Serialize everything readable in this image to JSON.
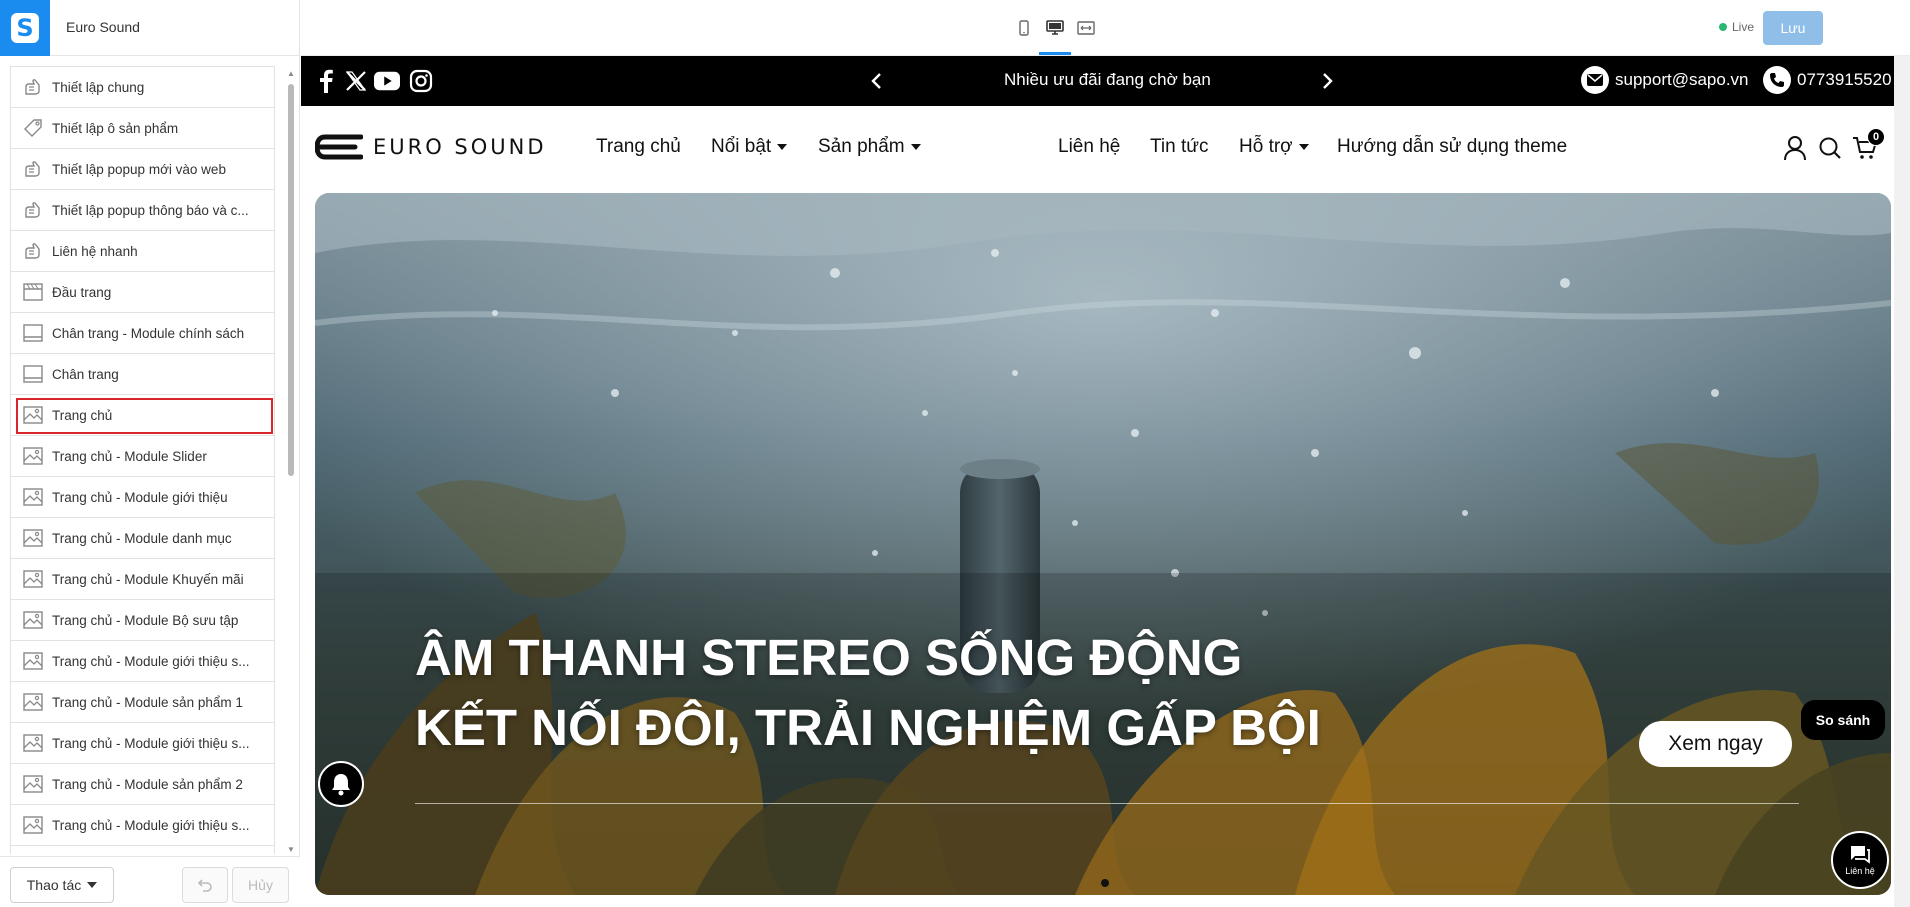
{
  "app": {
    "store_name": "Euro Sound",
    "logo_letter": "S"
  },
  "sidebar": {
    "items": [
      {
        "label": "Thiết lập chung",
        "icon": "settings-hand-icon"
      },
      {
        "label": "Thiết lập ô sản phẩm",
        "icon": "tag-icon"
      },
      {
        "label": "Thiết lập popup mới vào web",
        "icon": "settings-hand-icon"
      },
      {
        "label": "Thiết lập popup thông báo và c...",
        "icon": "settings-hand-icon"
      },
      {
        "label": "Liên hệ nhanh",
        "icon": "settings-hand-icon"
      },
      {
        "label": "Đầu trang",
        "icon": "header-layout-icon"
      },
      {
        "label": "Chân trang - Module chính sách",
        "icon": "footer-layout-icon"
      },
      {
        "label": "Chân trang",
        "icon": "footer-layout-icon"
      },
      {
        "label": "Trang chủ",
        "icon": "image-gallery-icon",
        "selected": true
      },
      {
        "label": "Trang chủ - Module Slider",
        "icon": "image-gallery-icon"
      },
      {
        "label": "Trang chủ - Module giới thiệu",
        "icon": "image-gallery-icon"
      },
      {
        "label": "Trang chủ - Module danh mục",
        "icon": "image-gallery-icon"
      },
      {
        "label": "Trang chủ - Module Khuyến mãi",
        "icon": "image-gallery-icon"
      },
      {
        "label": "Trang chủ - Module Bộ sưu tập",
        "icon": "image-gallery-icon"
      },
      {
        "label": "Trang chủ - Module giới thiệu s...",
        "icon": "image-gallery-icon"
      },
      {
        "label": "Trang chủ - Module sản phẩm 1",
        "icon": "image-gallery-icon"
      },
      {
        "label": "Trang chủ - Module giới thiệu s...",
        "icon": "image-gallery-icon"
      },
      {
        "label": "Trang chủ - Module sản phẩm 2",
        "icon": "image-gallery-icon"
      },
      {
        "label": "Trang chủ - Module giới thiệu s...",
        "icon": "image-gallery-icon"
      }
    ],
    "footer": {
      "actions_label": "Thao tác",
      "cancel_label": "Hủy"
    }
  },
  "toolbar": {
    "devices": [
      "mobile-icon",
      "desktop-icon",
      "fullwidth-icon"
    ],
    "active_device": "desktop-icon",
    "live_label": "Live",
    "save_label": "Lưu"
  },
  "site": {
    "promo_text": "Nhiều ưu đãi đang chờ bạn",
    "email": "support@sapo.vn",
    "phone": "0773915520",
    "logo_text": "EURO SOUND",
    "nav": [
      {
        "label": "Trang chủ",
        "dropdown": false
      },
      {
        "label": "Nổi bật",
        "dropdown": true
      },
      {
        "label": "Sản phẩm",
        "dropdown": true
      },
      {
        "label": "Liên hệ",
        "dropdown": false
      },
      {
        "label": "Tin tức",
        "dropdown": false
      },
      {
        "label": "Hỗ trợ",
        "dropdown": true
      },
      {
        "label": "Hướng dẫn sử dụng theme",
        "dropdown": false
      }
    ],
    "cart_count": "0",
    "hero": {
      "line1": "ÂM THANH STEREO SỐNG ĐỘNG",
      "line2": "KẾT NỐI ĐÔI, TRẢI NGHIỆM GẤP BỘI",
      "cta": "Xem ngay"
    },
    "compare_label": "So sánh",
    "contact_label": "Liên hệ"
  }
}
